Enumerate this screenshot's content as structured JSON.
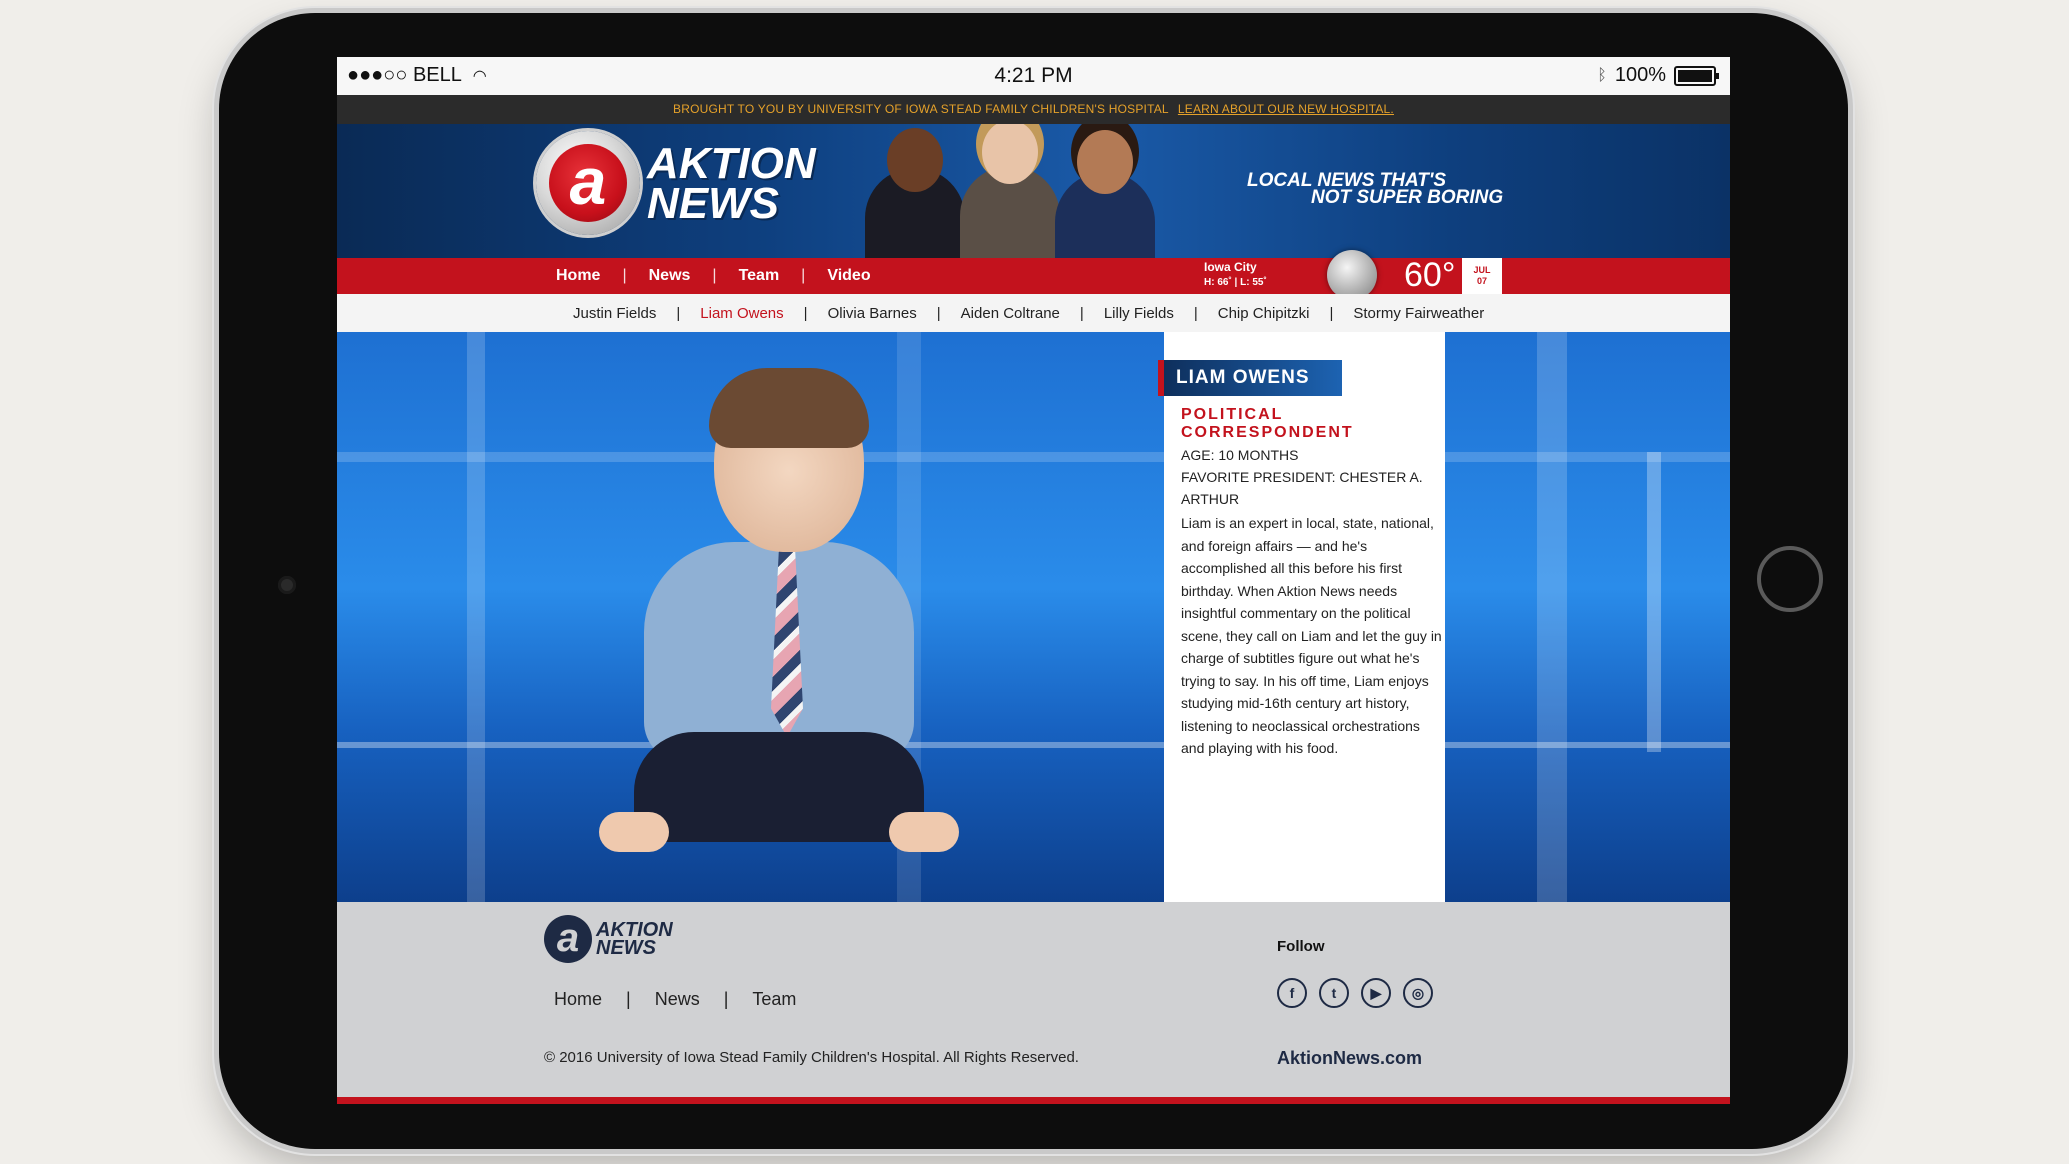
{
  "status": {
    "carrier": "●●●○○ BELL",
    "time": "4:21 PM",
    "battery": "100%"
  },
  "sponsor": {
    "text": "BROUGHT TO YOU BY UNIVERSITY OF IOWA STEAD FAMILY CHILDREN'S HOSPITAL",
    "link": "LEARN ABOUT OUR NEW HOSPITAL."
  },
  "header": {
    "logo_letter": "a",
    "logo_line1": "AKTION",
    "logo_line2": "NEWS",
    "tagline_line1": "LOCAL NEWS THAT'S",
    "tagline_line2": "NOT SUPER BORING"
  },
  "nav": {
    "items": [
      "Home",
      "News",
      "Team",
      "Video"
    ]
  },
  "weather": {
    "city": "Iowa City",
    "hilo": "H: 66˚  |  L: 55˚",
    "temp": "60°",
    "month": "JUL",
    "day": "07"
  },
  "team": {
    "members": [
      "Justin Fields",
      "Liam Owens",
      "Olivia Barnes",
      "Aiden Coltrane",
      "Lilly Fields",
      "Chip Chipitzki",
      "Stormy Fairweather"
    ],
    "active": "Liam Owens"
  },
  "profile": {
    "name": "LIAM OWENS",
    "role": "POLITICAL CORRESPONDENT",
    "age": "AGE: 10 MONTHS",
    "favorite": "FAVORITE PRESIDENT: CHESTER A. ARTHUR",
    "bio": "Liam is an expert in local, state, national, and foreign affairs — and he's accomplished all this before his first birthday. When Aktion News needs insightful commentary on the political scene, they call on Liam and let the guy in charge of subtitles figure out what he's trying to say. In his off time, Liam enjoys studying mid-16th century art history, listening to neoclassical orchestrations and playing with his food."
  },
  "footer": {
    "logo_letter": "a",
    "logo_line1": "AKTION",
    "logo_line2": "NEWS",
    "links": [
      "Home",
      "News",
      "Team"
    ],
    "copyright": "© 2016 University of Iowa Stead Family Children's Hospital. All Rights Reserved.",
    "follow": "Follow",
    "social": [
      "facebook-icon",
      "twitter-icon",
      "youtube-icon",
      "instagram-icon"
    ],
    "site": "AktionNews.com"
  },
  "colors": {
    "brand_red": "#c3121d",
    "navy": "#1e2a44",
    "sponsor_text": "#e5a12a"
  }
}
